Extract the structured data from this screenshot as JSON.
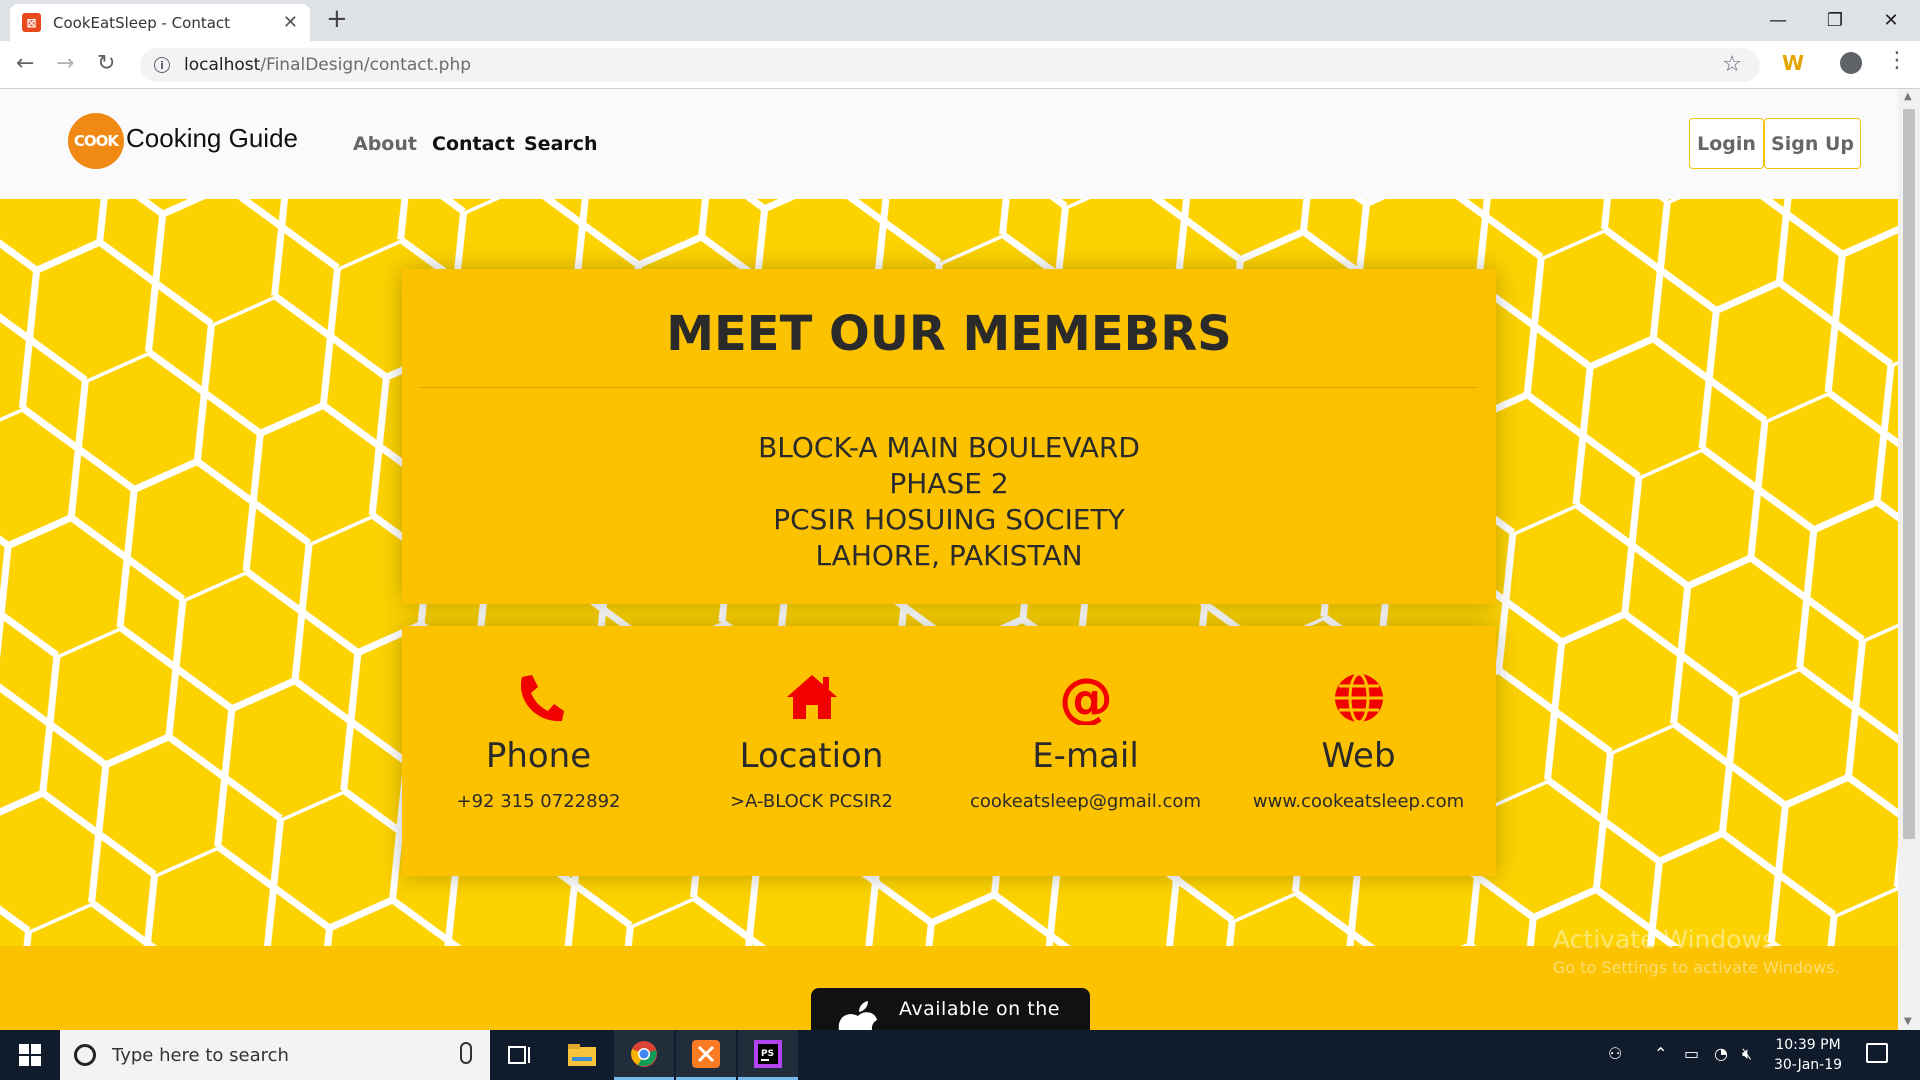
{
  "browser": {
    "tab_title": "CookEatSleep - Contact",
    "url_host": "localhost",
    "url_path": "/FinalDesign/contact.php"
  },
  "navbar": {
    "logo_text": "COOK",
    "brand": "Cooking Guide",
    "links": [
      "About",
      "Contact",
      "Search"
    ],
    "login": "Login",
    "signup": "Sign Up"
  },
  "card": {
    "title": "MEET OUR MEMEBRS",
    "address": [
      "BLOCK-A MAIN BOULEVARD",
      "PHASE 2",
      "PCSIR HOSUING SOCIETY",
      "LAHORE, PAKISTAN"
    ]
  },
  "contacts": [
    {
      "icon": "phone-icon",
      "label": "Phone",
      "value": "+92 315 0722892"
    },
    {
      "icon": "home-icon",
      "label": "Location",
      "value": ">A-BLOCK PCSIR2"
    },
    {
      "icon": "at-icon",
      "label": "E-mail",
      "value": "cookeatsleep@gmail.com"
    },
    {
      "icon": "globe-icon",
      "label": "Web",
      "value": "www.cookeatsleep.com"
    }
  ],
  "footer": {
    "store_badge": "Available on the"
  },
  "watermark": {
    "title": "Activate Windows",
    "subtitle": "Go to Settings to activate Windows."
  },
  "taskbar": {
    "search_placeholder": "Type here to search",
    "time": "10:39 PM",
    "date": "30-Jan-19"
  },
  "colors": {
    "hero_bg": "#fcd200",
    "card_bg": "#fcc200",
    "icon_red": "#f20000",
    "button_border": "#f1c40f"
  }
}
